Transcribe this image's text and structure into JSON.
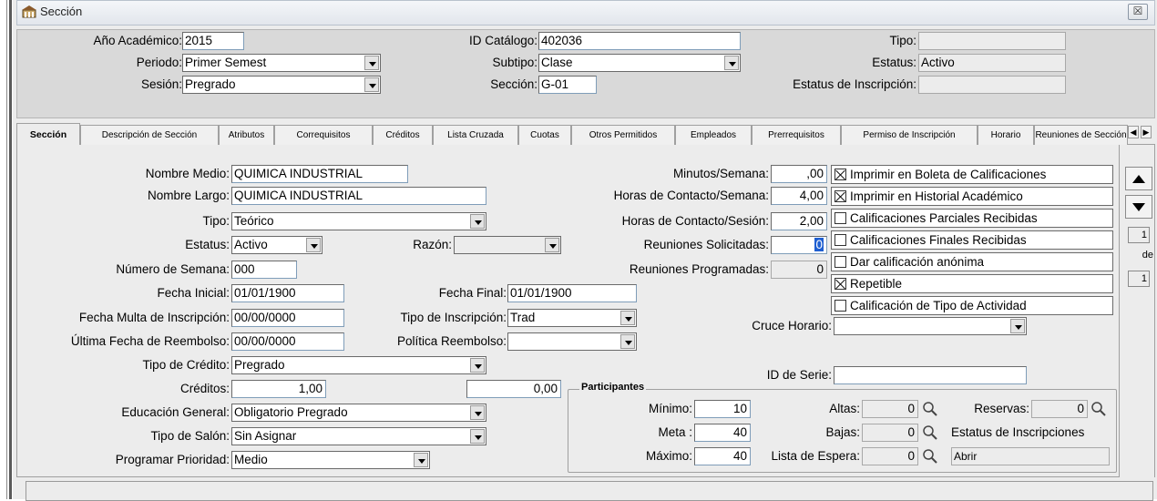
{
  "window": {
    "title": "Sección",
    "close": "☒"
  },
  "header": {
    "ano_label": "Año Académico:",
    "ano_value": "2015",
    "periodo_label": "Periodo:",
    "periodo_value": "Primer Semest",
    "sesion_label": "Sesión:",
    "sesion_value": "Pregrado",
    "idcat_label": "ID Catálogo:",
    "idcat_value": "402036",
    "subtipo_label": "Subtipo:",
    "subtipo_value": "Clase",
    "seccion_label": "Sección:",
    "seccion_value": "G-01",
    "tipo_label": "Tipo:",
    "tipo_value": "",
    "estatus_label": "Estatus:",
    "estatus_value": "Activo",
    "estatus_insc_label": "Estatus de Inscripción:",
    "estatus_insc_value": ""
  },
  "tabs": [
    "Sección",
    "Descripción de Sección",
    "Atributos",
    "Correquisitos",
    "Créditos",
    "Lista Cruzada",
    "Cuotas",
    "Otros Permitidos",
    "Empleados",
    "Prerrequisitos",
    "Permiso de Inscripción",
    "Horario",
    "Reuniones de Sección"
  ],
  "form": {
    "nombre_medio_label": "Nombre Medio:",
    "nombre_medio": "QUIMICA INDUSTRIAL",
    "nombre_largo_label": "Nombre Largo:",
    "nombre_largo": "QUIMICA INDUSTRIAL",
    "tipo_label": "Tipo:",
    "tipo": "Teórico",
    "estatus_label": "Estatus:",
    "estatus": "Activo",
    "razon_label": "Razón:",
    "razon": "",
    "num_semana_label": "Número de Semana:",
    "num_semana": "000",
    "fecha_inicial_label": "Fecha Inicial:",
    "fecha_inicial": "01/01/1900",
    "fecha_final_label": "Fecha Final:",
    "fecha_final": "01/01/1900",
    "fecha_multa_label": "Fecha Multa de Inscripción:",
    "fecha_multa": "00/00/0000",
    "tipo_insc_label": "Tipo de Inscripción:",
    "tipo_insc": "Trad",
    "ultima_reembolso_label": "Última Fecha de Reembolso:",
    "ultima_reembolso": "00/00/0000",
    "politica_label": "Política Reembolso:",
    "politica": "",
    "tipo_credito_label": "Tipo de Crédito:",
    "tipo_credito": "Pregrado",
    "creditos_label": "Créditos:",
    "creditos": "1,00",
    "creditos2": "0,00",
    "educ_general_label": "Educación General:",
    "educ_general": "Obligatorio Pregrado",
    "tipo_salon_label": "Tipo de Salón:",
    "tipo_salon": "Sin Asignar",
    "prioridad_label": "Programar Prioridad:",
    "prioridad": "Medio",
    "minutos_label": "Minutos/Semana:",
    "minutos": ",00",
    "horas_sem_label": "Horas de Contacto/Semana:",
    "horas_sem": "4,00",
    "horas_ses_label": "Horas de Contacto/Sesión:",
    "horas_ses": "2,00",
    "reun_sol_label": "Reuniones Solicitadas:",
    "reun_sol": "0",
    "reun_prog_label": "Reuniones Programadas:",
    "reun_prog": "0",
    "cruce_label": "Cruce Horario:",
    "cruce": "",
    "id_serie_label": "ID de Serie:",
    "id_serie": ""
  },
  "checks": [
    {
      "label": "Imprimir en Boleta de Calificaciones",
      "checked": true
    },
    {
      "label": "Imprimir en Historial Académico",
      "checked": true
    },
    {
      "label": "Calificaciones Parciales Recibidas",
      "checked": false
    },
    {
      "label": "Calificaciones Finales Recibidas",
      "checked": false
    },
    {
      "label": "Dar calificación anónima",
      "checked": false
    },
    {
      "label": "Repetible",
      "checked": true
    },
    {
      "label": "Calificación de Tipo de Actividad",
      "checked": false
    }
  ],
  "participantes": {
    "title": "Participantes",
    "minimo_label": "Mínimo:",
    "minimo": "10",
    "meta_label": "Meta :",
    "meta": "40",
    "maximo_label": "Máximo:",
    "maximo": "40",
    "altas_label": "Altas:",
    "altas": "0",
    "bajas_label": "Bajas:",
    "bajas": "0",
    "espera_label": "Lista de Espera:",
    "espera": "0",
    "reservas_label": "Reservas:",
    "reservas": "0",
    "estatus_insc_label": "Estatus de Inscripciones",
    "estatus_insc": "Abrir"
  },
  "nav": {
    "page": "1",
    "de": "de",
    "total": "1"
  }
}
